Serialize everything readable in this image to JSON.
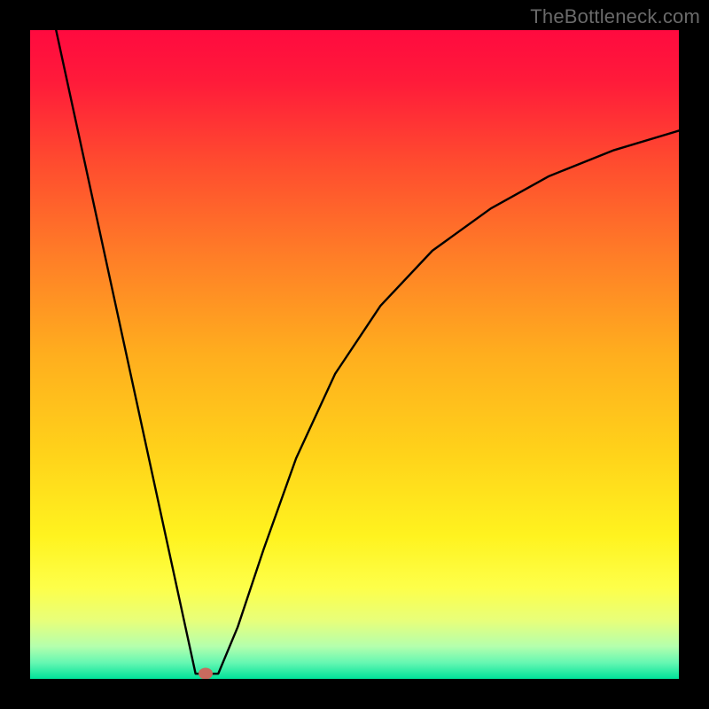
{
  "watermark": "TheBottleneck.com",
  "chart_data": {
    "type": "line",
    "title": "",
    "xlabel": "",
    "ylabel": "",
    "xlim": [
      0,
      100
    ],
    "ylim": [
      0,
      100
    ],
    "grid": false,
    "legend": false,
    "gradient_stops": [
      {
        "offset": 0.0,
        "color": "#ff0a3f"
      },
      {
        "offset": 0.08,
        "color": "#ff1b3a"
      },
      {
        "offset": 0.2,
        "color": "#ff4a2f"
      },
      {
        "offset": 0.35,
        "color": "#ff7e27"
      },
      {
        "offset": 0.5,
        "color": "#ffae1e"
      },
      {
        "offset": 0.65,
        "color": "#ffd21a"
      },
      {
        "offset": 0.78,
        "color": "#fff31f"
      },
      {
        "offset": 0.86,
        "color": "#fdff4a"
      },
      {
        "offset": 0.91,
        "color": "#e8ff7a"
      },
      {
        "offset": 0.95,
        "color": "#b4ffad"
      },
      {
        "offset": 0.975,
        "color": "#66f7b2"
      },
      {
        "offset": 1.0,
        "color": "#00e29a"
      }
    ],
    "series": [
      {
        "name": "bottleneck-curve",
        "stroke": "#000000",
        "stroke_width": 2.4,
        "segments": [
          {
            "kind": "line",
            "from": [
              4.0,
              100.0
            ],
            "to": [
              25.5,
              0.8
            ]
          },
          {
            "kind": "flat",
            "from": [
              25.5,
              0.8
            ],
            "to": [
              29.0,
              0.8
            ]
          },
          {
            "kind": "curve_right",
            "x": [
              29.0,
              32.0,
              36.0,
              41.0,
              47.0,
              54.0,
              62.0,
              71.0,
              80.0,
              90.0,
              100.0
            ],
            "y": [
              0.8,
              8.0,
              20.0,
              34.0,
              47.0,
              57.5,
              66.0,
              72.5,
              77.5,
              81.5,
              84.5
            ]
          }
        ]
      }
    ],
    "marker": {
      "x": 27.0,
      "y": 0.8,
      "color": "#c96a5e"
    }
  }
}
